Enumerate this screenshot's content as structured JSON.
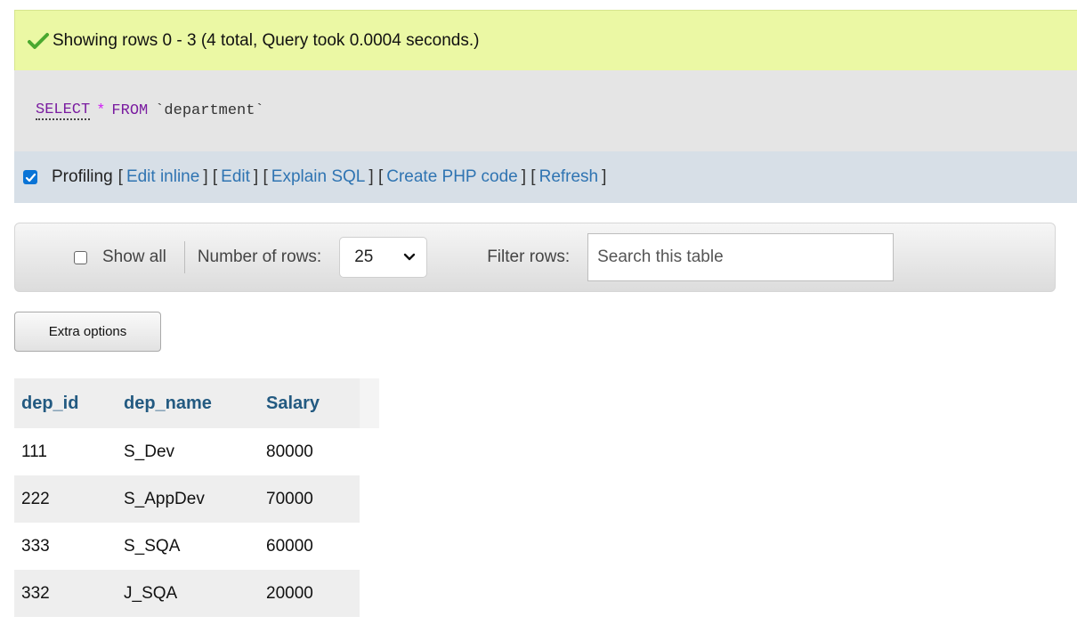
{
  "success": {
    "message": "Showing rows 0 - 3 (4 total, Query took 0.0004 seconds.)",
    "icon": "check-icon",
    "color": "#ebf8a4"
  },
  "sql": {
    "select": "SELECT",
    "star": "*",
    "from": "FROM",
    "table": "`department`"
  },
  "profiling": {
    "label": "Profiling",
    "checked": true,
    "links": [
      "Edit inline",
      "Edit",
      "Explain SQL",
      "Create PHP code",
      "Refresh"
    ]
  },
  "toolbar": {
    "show_all": "Show all",
    "number_of_rows_label": "Number of rows:",
    "rows_value": "25",
    "filter_label": "Filter rows:",
    "search_placeholder": "Search this table"
  },
  "extra_options": "Extra options",
  "table": {
    "headers": [
      "dep_id",
      "dep_name",
      "Salary"
    ],
    "rows": [
      [
        "111",
        "S_Dev",
        "80000"
      ],
      [
        "222",
        "S_AppDev",
        "70000"
      ],
      [
        "333",
        "S_SQA",
        "60000"
      ],
      [
        "332",
        "J_SQA",
        "20000"
      ]
    ],
    "header_color": "#235a81"
  }
}
